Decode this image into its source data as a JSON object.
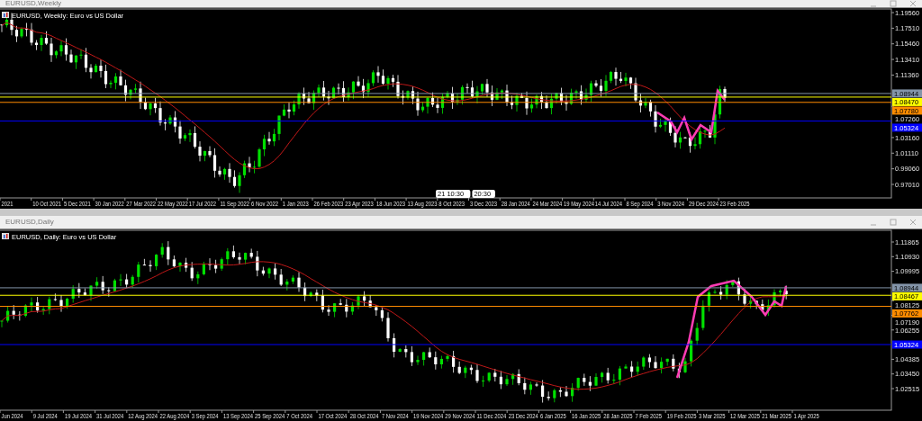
{
  "charts": [
    {
      "window_title": "EURUSD,Weekly",
      "header": "EURUSD, Weekly:  Euro vs US Dollar",
      "price_ticks": [
        "1.19560",
        "1.17510",
        "1.15460",
        "1.13410",
        "1.11360",
        "1.07260",
        "1.03160",
        "1.01110",
        "0.99060",
        "0.97010"
      ],
      "levels": [
        {
          "price": "1.08944",
          "color": "#8394a8"
        },
        {
          "price": "1.08470",
          "color": "#ffff00"
        },
        {
          "price": "1.07780",
          "color": "#ff8c00"
        },
        {
          "price": "1.05324",
          "color": "#0000ff"
        }
      ],
      "date_ticks": [
        "2021",
        "10 Oct 2021",
        "5 Dec 2021",
        "30 Jan 2022",
        "27 Mar 2022",
        "22 May 2022",
        "17 Jul 2022",
        "11 Sep 2022",
        "6 Nov 2022",
        "1 Jan 2023",
        "26 Feb 2023",
        "23 Apr 2023",
        "18 Jun 2023",
        "13 Aug 2023",
        "8 Oct 2023",
        "3 Dec 2023",
        "28 Jan 2024",
        "24 Mar 2024",
        "19 May 2024",
        "14 Jul 2024",
        "8 Sep 2024",
        "3 Nov 2024",
        "29 Dec 2024",
        "23 Feb 2025"
      ],
      "crosshair_labels": [
        "21 10:30",
        "20:30"
      ]
    },
    {
      "window_title": "EURUSD,Daily",
      "header": "EURUSD, Daily:  Euro vs US Dollar",
      "price_ticks": [
        "1.11865",
        "1.10930",
        "1.09995",
        "1.08125",
        "1.07190",
        "1.06255",
        "1.04385",
        "1.03450",
        "1.02515"
      ],
      "levels": [
        {
          "price": "1.08944",
          "color": "#8394a8"
        },
        {
          "price": "1.08467",
          "color": "#ffff00"
        },
        {
          "price": "1.07762",
          "color": "#ff8c00"
        },
        {
          "price": "1.05324",
          "color": "#0000ff"
        }
      ],
      "date_ticks": [
        "Jun 2024",
        "9 Jul 2024",
        "19 Jul 2024",
        "31 Jul 2024",
        "12 Aug 2024",
        "22 Aug 2024",
        "3 Sep 2024",
        "13 Sep 2024",
        "25 Sep 2024",
        "7 Oct 2024",
        "17 Oct 2024",
        "28 Oct 2024",
        "7 Nov 2024",
        "19 Nov 2024",
        "29 Nov 2024",
        "11 Dec 2024",
        "23 Dec 2024",
        "6 Jan 2025",
        "16 Jan 2025",
        "28 Jan 2025",
        "7 Feb 2025",
        "19 Feb 2025",
        "3 Mar 2025",
        "12 Mar 2025",
        "21 Mar 2025",
        "1 Apr 2025"
      ]
    }
  ]
}
